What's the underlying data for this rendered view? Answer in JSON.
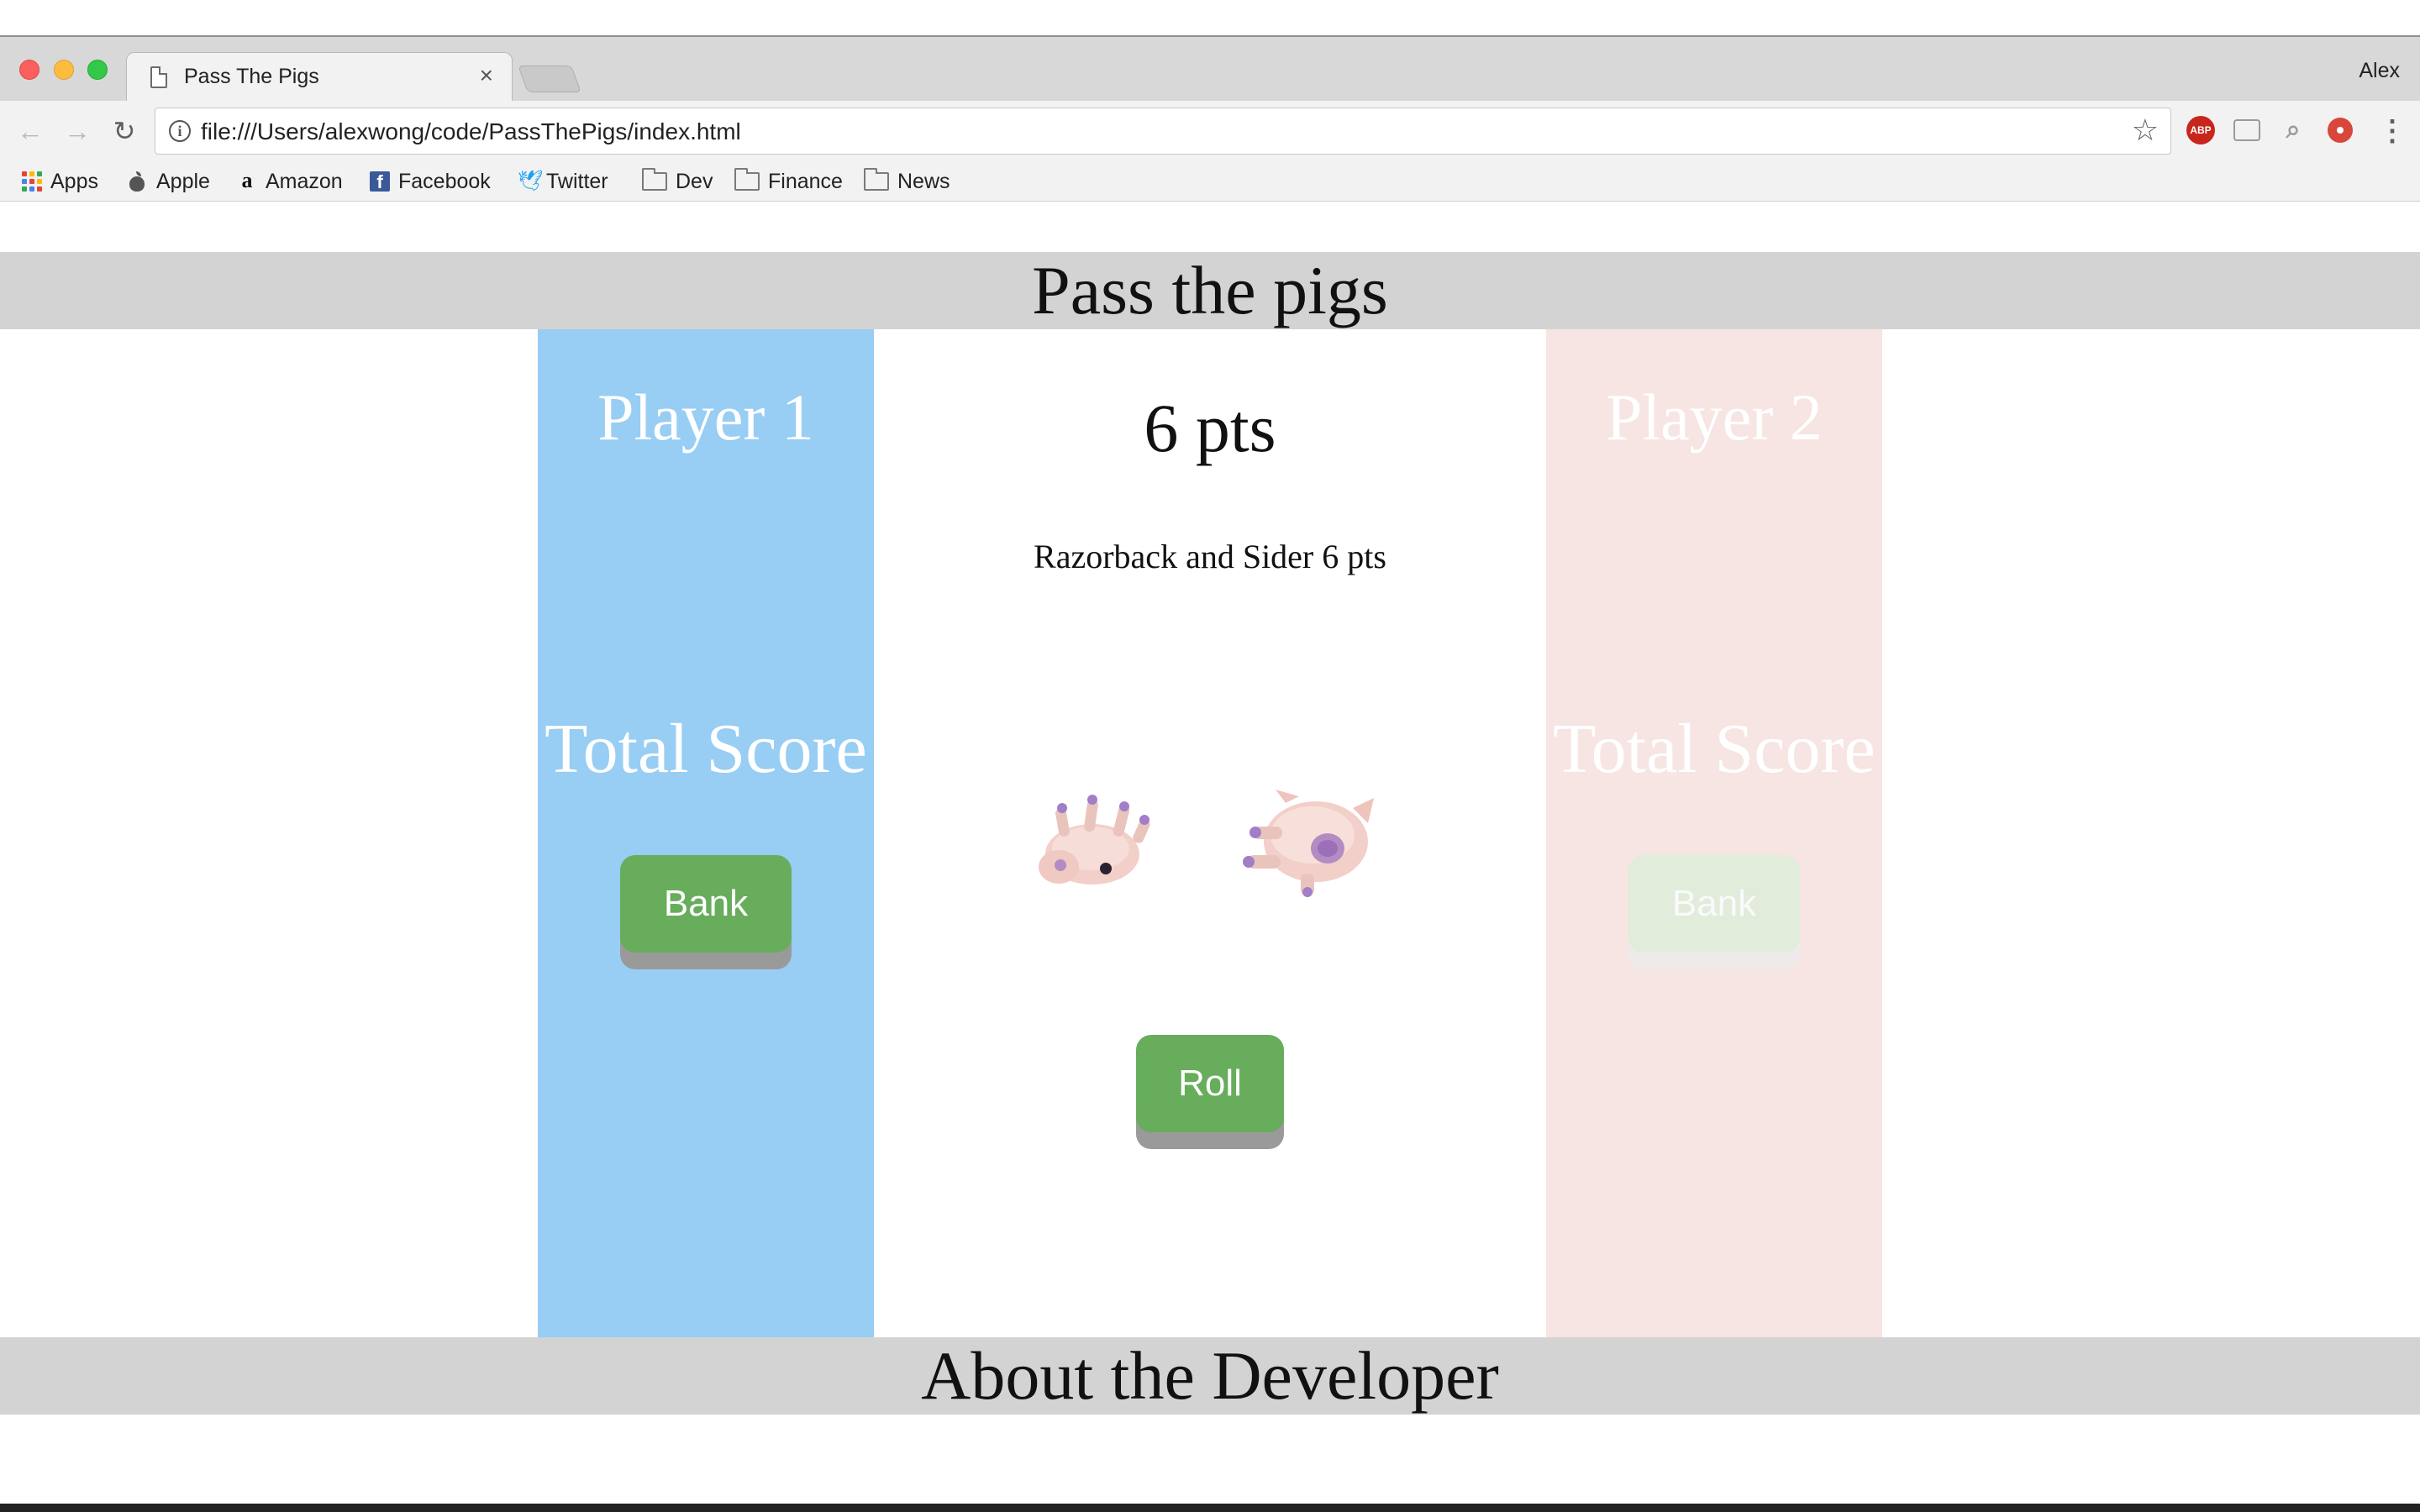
{
  "browser": {
    "tab_title": "Pass The Pigs",
    "profile_name": "Alex",
    "url": "file:///Users/alexwong/code/PassThePigs/index.html",
    "extensions": [
      "ABP"
    ],
    "bookmarks": [
      {
        "label": "Apps",
        "icon": "apps-grid-icon"
      },
      {
        "label": "Apple",
        "icon": "apple-icon"
      },
      {
        "label": "Amazon",
        "icon": "amazon-icon"
      },
      {
        "label": "Facebook",
        "icon": "facebook-icon"
      },
      {
        "label": "Twitter",
        "icon": "twitter-icon"
      },
      {
        "label": "Dev",
        "icon": "folder-icon"
      },
      {
        "label": "Finance",
        "icon": "folder-icon"
      },
      {
        "label": "News",
        "icon": "folder-icon"
      }
    ]
  },
  "page": {
    "title": "Pass the pigs",
    "player1": {
      "name": "Player 1",
      "total_label": "Total Score",
      "bank_label": "Bank",
      "active": true,
      "panel_color": "#98cdf4"
    },
    "player2": {
      "name": "Player 2",
      "total_label": "Total Score",
      "bank_label": "Bank",
      "active": false,
      "panel_color": "#f6e5e3"
    },
    "turn": {
      "points": "6 pts",
      "description": "Razorback and Sider 6 pts"
    },
    "roll_label": "Roll",
    "footer_title": "About the Developer",
    "button_color": "#67ad5b"
  }
}
